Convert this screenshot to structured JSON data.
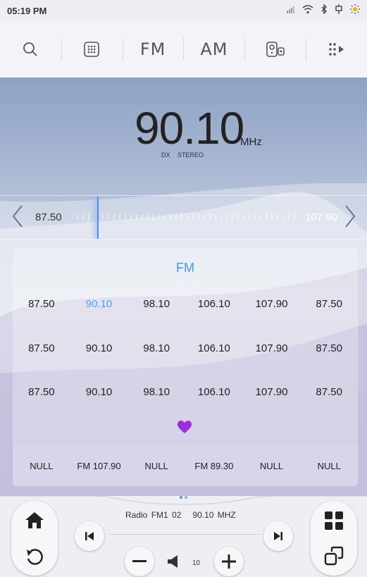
{
  "status": {
    "time": "05:19 PM"
  },
  "toolbar": {
    "fm_label": "FM",
    "am_label": "AM"
  },
  "tuner": {
    "frequency": "90.10",
    "unit": "MHz",
    "tag_dx": "DX",
    "tag_stereo": "STEREO",
    "range_low": "87.50",
    "range_high": "107.90"
  },
  "presets": {
    "band": "FM",
    "rows": [
      [
        "87.50",
        "90.10",
        "98.10",
        "106.10",
        "107.90",
        "87.50"
      ],
      [
        "87.50",
        "90.10",
        "98.10",
        "106.10",
        "107.90",
        "87.50"
      ],
      [
        "87.50",
        "90.10",
        "98.10",
        "106.10",
        "107.90",
        "87.50"
      ]
    ],
    "active_value": "90.10",
    "favorites": [
      "NULL",
      "FM 107.90",
      "NULL",
      "FM 89.30",
      "NULL",
      "NULL"
    ]
  },
  "player": {
    "source": "Radio",
    "preset": "FM1 02",
    "station": "90.10 MHZ",
    "volume": "10"
  },
  "colors": {
    "accent": "#3d9bea",
    "heart": "#9b30d9"
  },
  "page_indicator": {
    "pages": 2,
    "current": 1
  }
}
